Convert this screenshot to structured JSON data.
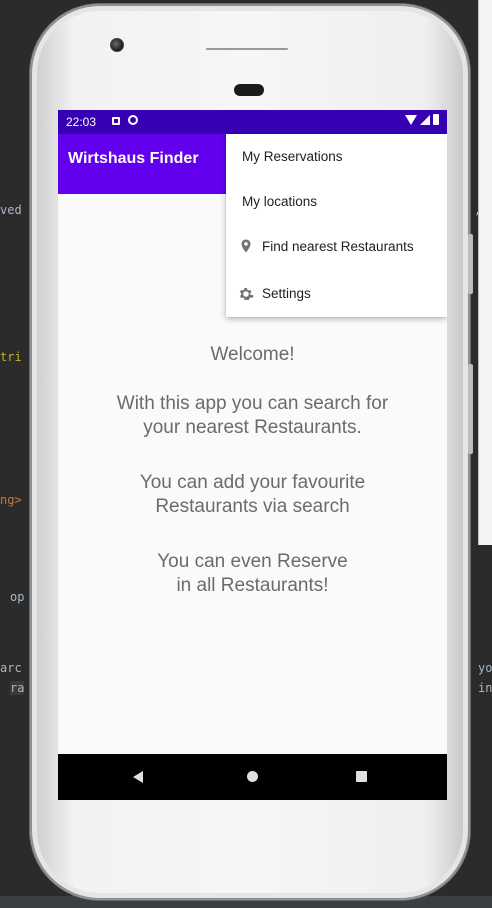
{
  "ide": {
    "fragments": {
      "f1": "ved",
      "f2": "tri",
      "f3": "ng>",
      "f4": "op",
      "f5": "arc",
      "f6": "ra",
      "f7": ",",
      "f8": "yo",
      "f9": "in"
    }
  },
  "status_bar": {
    "time": "22:03"
  },
  "app_bar": {
    "title": "Wirtshaus Finder"
  },
  "menu": {
    "items": [
      {
        "label": "My Reservations",
        "icon": null
      },
      {
        "label": "My locations",
        "icon": null
      },
      {
        "label": "Find nearest Restaurants",
        "icon": "location-pin-icon"
      },
      {
        "label": "Settings",
        "icon": "gear-icon"
      }
    ]
  },
  "content": {
    "welcome": "Welcome!",
    "paragraph1_line1": "With this app you can search for",
    "paragraph1_line2": "your nearest Restaurants.",
    "paragraph2_line1": "You can add your favourite",
    "paragraph2_line2": "Restaurants via search",
    "paragraph3_line1": "You can even Reserve",
    "paragraph3_line2": "in all Restaurants!"
  },
  "colors": {
    "status_bar": "#3700b3",
    "app_bar": "#6200ee",
    "text_secondary": "#6b6b6b"
  }
}
